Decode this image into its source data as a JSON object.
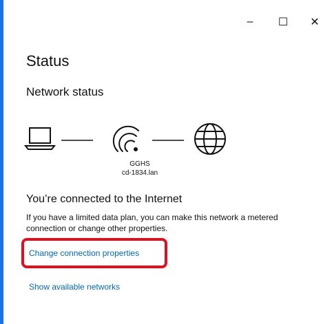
{
  "titlebar": {
    "minimize_glyph": "–",
    "maximize_glyph": "☐",
    "close_glyph": "✕"
  },
  "page": {
    "title": "Status",
    "section_title": "Network status"
  },
  "network": {
    "name": "GGHS",
    "domain": "cd-1834.lan"
  },
  "status": {
    "heading": "You’re connected to the Internet",
    "description": "If you have a limited data plan, you can make this network a metered connection or change other properties."
  },
  "links": {
    "change_connection": "Change connection properties",
    "show_networks": "Show available networks"
  },
  "colors": {
    "link": "#0067c0",
    "highlight": "#e0101e",
    "window_border": "#1a73e8"
  },
  "icons": {
    "laptop": "laptop-icon",
    "wifi": "wifi-icon",
    "globe": "globe-icon"
  }
}
